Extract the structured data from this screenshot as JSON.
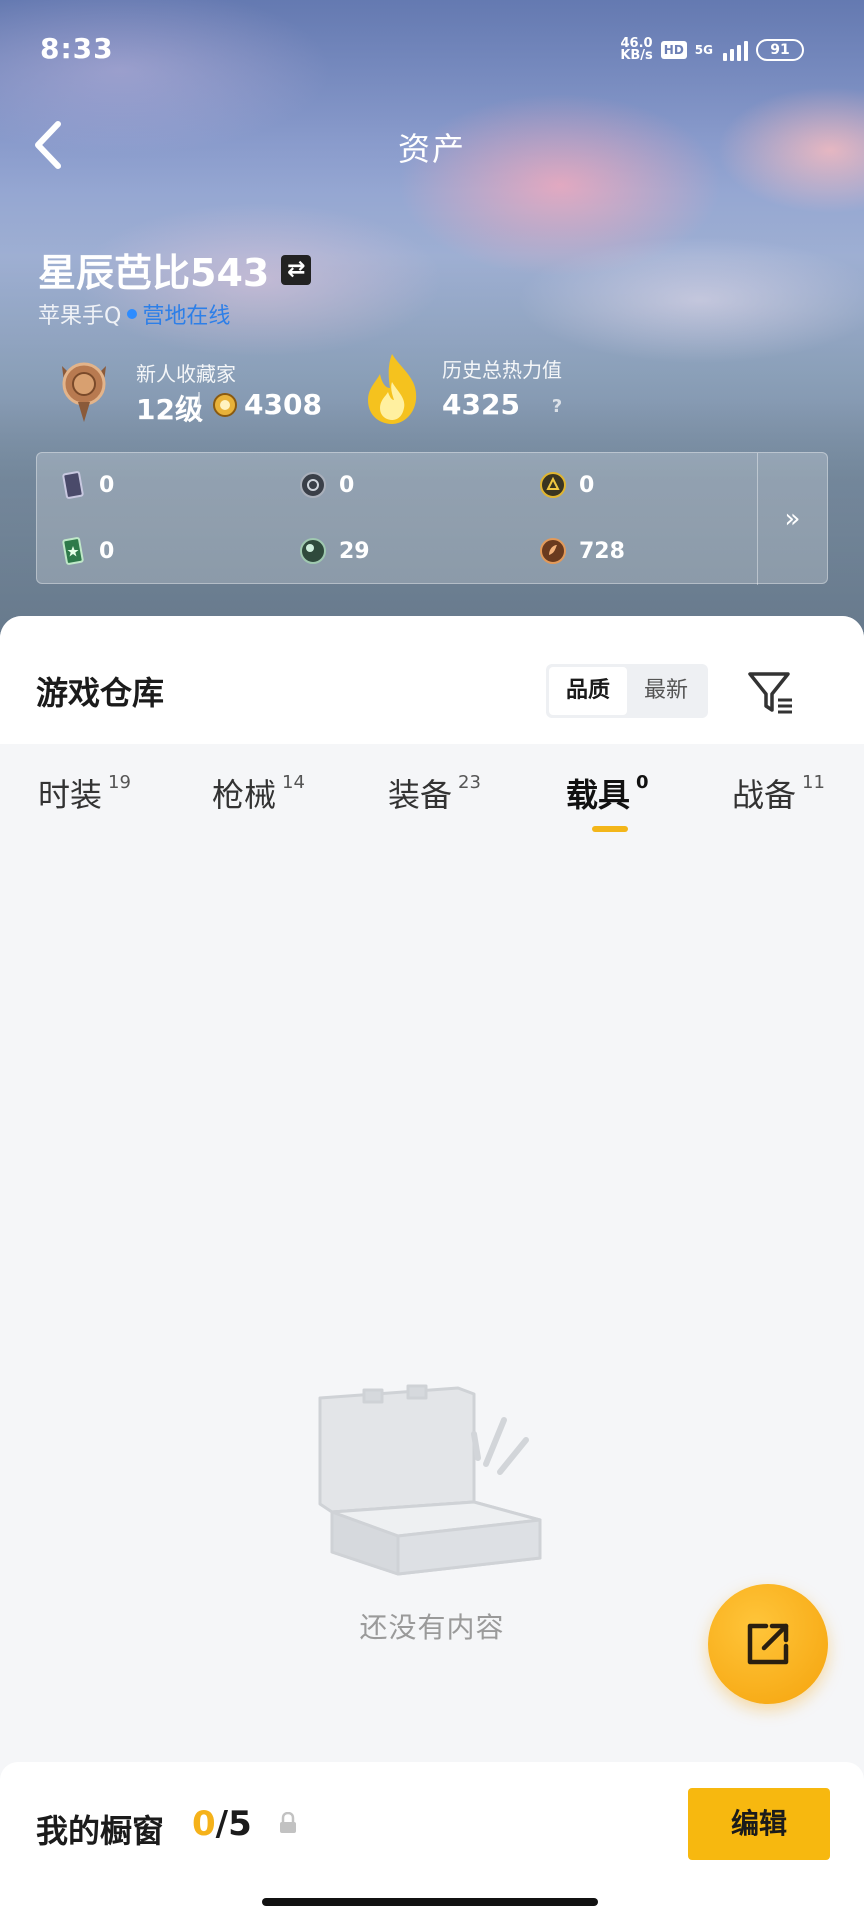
{
  "status_bar": {
    "time": "8:33",
    "net_speed_value": "46.0",
    "net_speed_unit": "KB/s",
    "hd": "HD",
    "network": "5G",
    "battery": "91"
  },
  "header": {
    "title": "资产"
  },
  "user": {
    "name": "星辰芭比543",
    "swap_symbol": "⇄",
    "platform": "苹果手Q",
    "online_status": "营地在线"
  },
  "stats": {
    "collector_title": "新人收藏家",
    "collector_level": "12级",
    "coins": "4308",
    "heat_title": "历史总热力值",
    "heat_value": "4325",
    "help": "?"
  },
  "currencies": [
    {
      "icon": "purple-card-icon",
      "value": "0"
    },
    {
      "icon": "dark-coin-icon",
      "value": "0"
    },
    {
      "icon": "gold-coin-icon",
      "value": "0"
    },
    {
      "icon": "green-card-icon",
      "value": "0"
    },
    {
      "icon": "green-orb-icon",
      "value": "29"
    },
    {
      "icon": "bronze-coin-icon",
      "value": "728"
    }
  ],
  "currency_more": "»",
  "warehouse": {
    "title": "游戏仓库",
    "sort_options": [
      "品质",
      "最新"
    ],
    "active_sort": "品质",
    "tabs": [
      {
        "label": "时装",
        "count": "19"
      },
      {
        "label": "枪械",
        "count": "14"
      },
      {
        "label": "装备",
        "count": "23"
      },
      {
        "label": "载具",
        "count": "0"
      },
      {
        "label": "战备",
        "count": "11"
      }
    ],
    "active_tab": "载具",
    "empty_text": "还没有内容"
  },
  "showcase": {
    "label": "我的橱窗",
    "current": "0",
    "separator": "/",
    "max": "5",
    "edit_label": "编辑"
  },
  "colors": {
    "accent": "#f7b80f",
    "online": "#2d7fe8",
    "tab_indicator": "#f3b61a"
  }
}
